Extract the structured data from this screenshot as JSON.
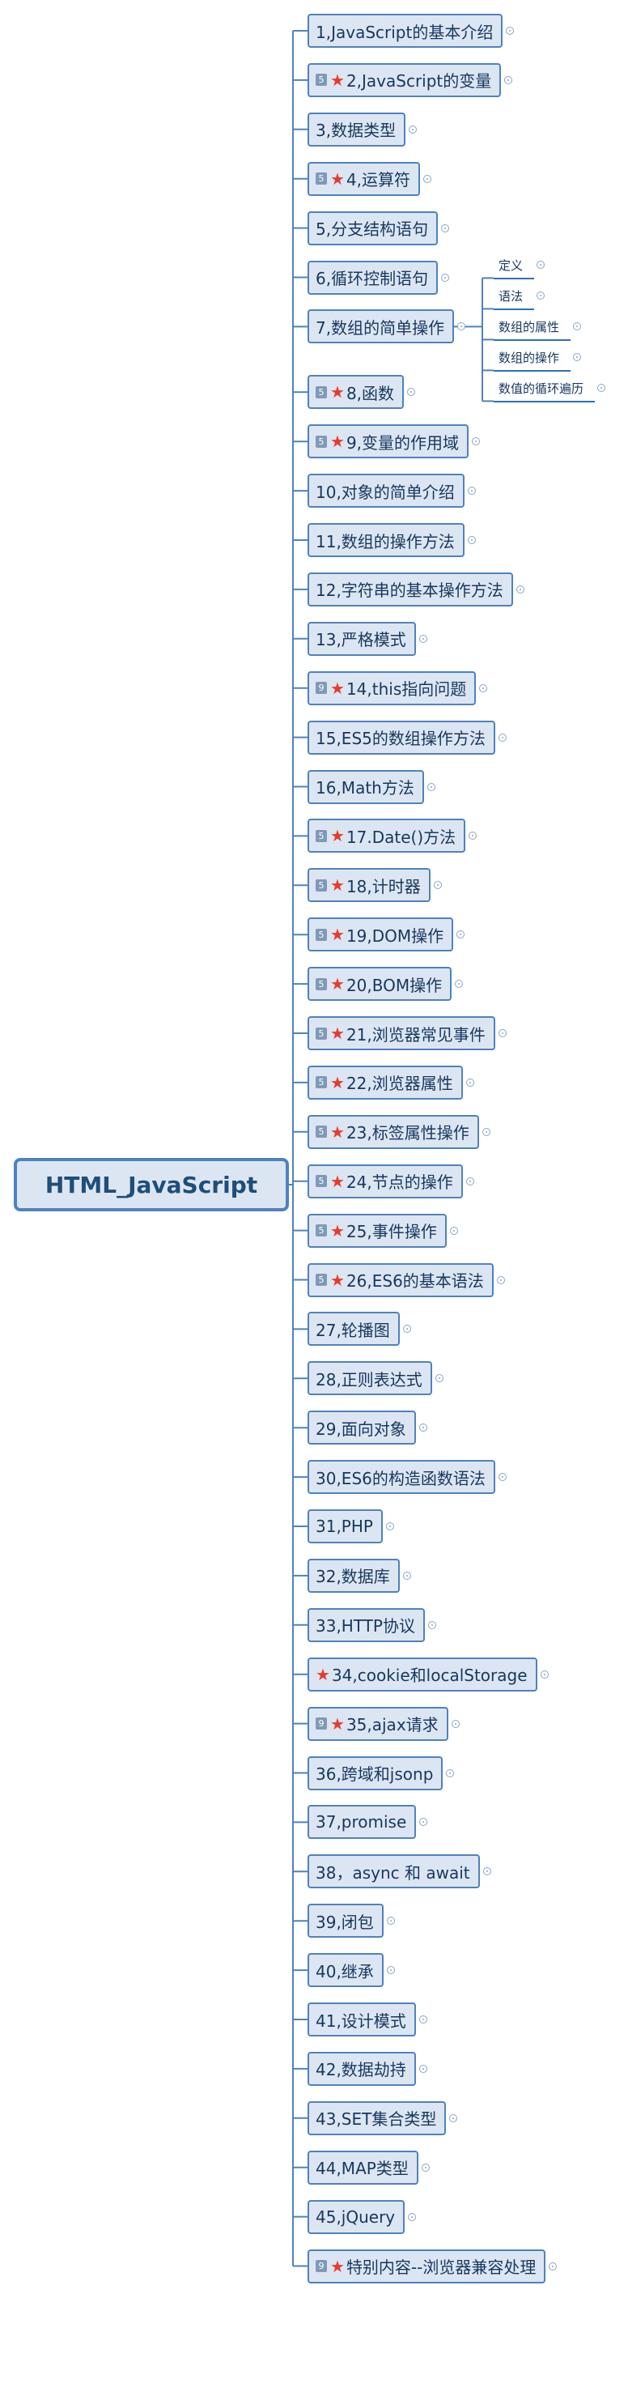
{
  "root": {
    "label": "HTML_JavaScript"
  },
  "colors": {
    "accent": "#4f82be",
    "node_fill": "#dce6f2",
    "star": "#e63b2e",
    "badge": "#7f9ab7"
  },
  "branches": [
    {
      "label": "1,JavaScript的基本介绍"
    },
    {
      "label": "2,JavaScript的变量",
      "badge": "5",
      "star": true
    },
    {
      "label": "3,数据类型"
    },
    {
      "label": "4,运算符",
      "badge": "5",
      "star": true
    },
    {
      "label": "5,分支结构语句"
    },
    {
      "label": "6,循环控制语句"
    },
    {
      "label": "7,数组的简单操作"
    },
    {
      "label": "8,函数",
      "badge": "5",
      "star": true
    },
    {
      "label": "9,变量的作用域",
      "badge": "5",
      "star": true
    },
    {
      "label": "10,对象的简单介绍"
    },
    {
      "label": "11,数组的操作方法"
    },
    {
      "label": "12,字符串的基本操作方法"
    },
    {
      "label": "13,严格模式"
    },
    {
      "label": "14,this指向问题",
      "badge": "9",
      "star": true
    },
    {
      "label": "15,ES5的数组操作方法"
    },
    {
      "label": "16,Math方法"
    },
    {
      "label": "17.Date()方法",
      "badge": "5",
      "star": true
    },
    {
      "label": "18,计时器",
      "badge": "5",
      "star": true
    },
    {
      "label": "19,DOM操作",
      "badge": "5",
      "star": true
    },
    {
      "label": "20,BOM操作",
      "badge": "5",
      "star": true
    },
    {
      "label": "21,浏览器常见事件",
      "badge": "5",
      "star": true
    },
    {
      "label": "22,浏览器属性",
      "badge": "5",
      "star": true
    },
    {
      "label": "23,标签属性操作",
      "badge": "5",
      "star": true
    },
    {
      "label": "24,节点的操作",
      "badge": "5",
      "star": true
    },
    {
      "label": "25,事件操作",
      "badge": "5",
      "star": true
    },
    {
      "label": "26,ES6的基本语法",
      "badge": "5",
      "star": true
    },
    {
      "label": "27,轮播图"
    },
    {
      "label": "28,正则表达式"
    },
    {
      "label": "29,面向对象"
    },
    {
      "label": "30,ES6的构造函数语法"
    },
    {
      "label": "31,PHP"
    },
    {
      "label": "32,数据库"
    },
    {
      "label": "33,HTTP协议"
    },
    {
      "label": "34,cookie和localStorage",
      "star": true
    },
    {
      "label": "35,ajax请求",
      "badge": "9",
      "star": true
    },
    {
      "label": "36,跨域和jsonp"
    },
    {
      "label": "37,promise"
    },
    {
      "label": "38，async 和 await"
    },
    {
      "label": "39,闭包"
    },
    {
      "label": "40,继承"
    },
    {
      "label": "41,设计模式"
    },
    {
      "label": "42,数据劫持"
    },
    {
      "label": "43,SET集合类型"
    },
    {
      "label": "44,MAP类型"
    },
    {
      "label": "45,jQuery"
    },
    {
      "label": "特别内容--浏览器兼容处理",
      "badge": "9",
      "star": true
    }
  ],
  "sub_branches": [
    {
      "label": "定义"
    },
    {
      "label": "语法"
    },
    {
      "label": "数组的属性"
    },
    {
      "label": "数组的操作"
    },
    {
      "label": "数值的循环遍历"
    }
  ]
}
